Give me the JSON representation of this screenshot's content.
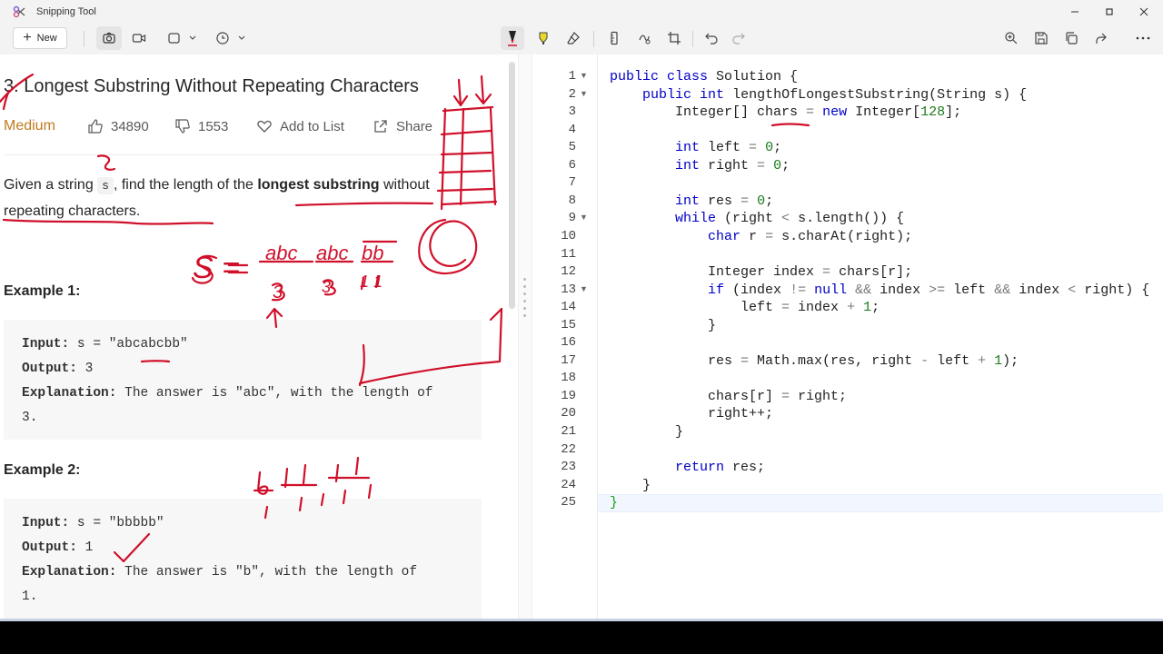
{
  "window": {
    "title": "Snipping Tool"
  },
  "toolbar": {
    "new_label": "New"
  },
  "problem": {
    "title": "3. Longest Substring Without Repeating Characters",
    "difficulty": "Medium",
    "likes": "34890",
    "dislikes": "1553",
    "add_to_list": "Add to List",
    "share": "Share",
    "description": {
      "part1": "Given a string ",
      "code": "s",
      "part2": ", find the length of the ",
      "bold": "longest substring",
      "part3": " without repeating characters."
    },
    "examples": [
      {
        "title": "Example 1:",
        "input_label": "Input:",
        "input_value": " s = \"abcabcbb\"",
        "output_label": "Output:",
        "output_value": " 3",
        "explanation_label": "Explanation:",
        "explanation_value": " The answer is \"abc\", with the length of",
        "explanation_cont": "3."
      },
      {
        "title": "Example 2:",
        "input_label": "Input:",
        "input_value": " s = \"bbbbb\"",
        "output_label": "Output:",
        "output_value": " 1",
        "explanation_label": "Explanation:",
        "explanation_value": " The answer is \"b\", with the length of",
        "explanation_cont": "1."
      }
    ]
  },
  "editor": {
    "line_numbers": [
      "1",
      "2",
      "3",
      "4",
      "5",
      "6",
      "7",
      "8",
      "9",
      "10",
      "11",
      "12",
      "13",
      "14",
      "15",
      "16",
      "17",
      "18",
      "19",
      "20",
      "21",
      "22",
      "23",
      "24",
      "25"
    ],
    "code_lines": [
      "public class Solution {",
      "    public int lengthOfLongestSubstring(String s) {",
      "        Integer[] chars = new Integer[128];",
      "",
      "        int left = 0;",
      "        int right = 0;",
      "",
      "        int res = 0;",
      "        while (right < s.length()) {",
      "            char r = s.charAt(right);",
      "",
      "            Integer index = chars[r];",
      "            if (index != null && index >= left && index < right) {",
      "                left = index + 1;",
      "            }",
      "",
      "            res = Math.max(res, right - left + 1);",
      "",
      "            chars[r] = right;",
      "            right++;",
      "        }",
      "",
      "        return res;",
      "    }",
      "}"
    ]
  },
  "annotations": {
    "s_eq": "S =",
    "grp1": "abc",
    "grp2": "abc",
    "grp3": "bb",
    "n1": "3",
    "n2": "3",
    "n3": "1 1",
    "ex2_letters": "b  bb  b  b",
    "ex2_counts": "1  1  1  1  1"
  },
  "colors": {
    "ink": "#d0102a",
    "accent": "#c07a1e"
  }
}
